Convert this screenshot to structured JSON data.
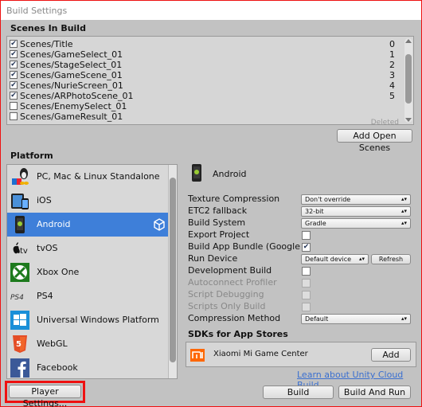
{
  "window": {
    "title": "Build Settings"
  },
  "scenes": {
    "header": "Scenes In Build",
    "items": [
      {
        "name": "Scenes/Title",
        "checked": true,
        "index": "0"
      },
      {
        "name": "Scenes/GameSelect_01",
        "checked": true,
        "index": "1"
      },
      {
        "name": "Scenes/StageSelect_01",
        "checked": true,
        "index": "2"
      },
      {
        "name": "Scenes/GameScene_01",
        "checked": true,
        "index": "3"
      },
      {
        "name": "Scenes/NurieScreen_01",
        "checked": true,
        "index": "4"
      },
      {
        "name": "Scenes/ARPhotoScene_01",
        "checked": true,
        "index": "5"
      },
      {
        "name": "Scenes/EnemySelect_01",
        "checked": false,
        "index": ""
      },
      {
        "name": "Scenes/GameResult_01",
        "checked": false,
        "index": ""
      }
    ],
    "deleted_label": "Deleted",
    "add_open_scenes": "Add Open Scenes"
  },
  "platform": {
    "header": "Platform",
    "items": [
      {
        "label": "PC, Mac & Linux Standalone",
        "icon": "pc-mac-linux-icon"
      },
      {
        "label": "iOS",
        "icon": "ios-icon"
      },
      {
        "label": "Android",
        "icon": "android-icon",
        "selected": true
      },
      {
        "label": "tvOS",
        "icon": "tvos-icon"
      },
      {
        "label": "Xbox One",
        "icon": "xbox-icon"
      },
      {
        "label": "PS4",
        "icon": "ps4-icon"
      },
      {
        "label": "Universal Windows Platform",
        "icon": "windows-icon"
      },
      {
        "label": "WebGL",
        "icon": "html5-icon"
      },
      {
        "label": "Facebook",
        "icon": "facebook-icon"
      }
    ],
    "player_settings": "Player Settings..."
  },
  "android": {
    "title": "Android",
    "texture_compression": {
      "label": "Texture Compression",
      "value": "Don't override"
    },
    "etc2_fallback": {
      "label": "ETC2 fallback",
      "value": "32-bit"
    },
    "build_system": {
      "label": "Build System",
      "value": "Gradle"
    },
    "export_project": {
      "label": "Export Project",
      "checked": false
    },
    "build_app_bundle": {
      "label": "Build App Bundle (Google Play)",
      "checked": true
    },
    "run_device": {
      "label": "Run Device",
      "value": "Default device",
      "refresh": "Refresh"
    },
    "development_build": {
      "label": "Development Build",
      "checked": false
    },
    "autoconnect_profiler": {
      "label": "Autoconnect Profiler"
    },
    "script_debugging": {
      "label": "Script Debugging"
    },
    "scripts_only_build": {
      "label": "Scripts Only Build"
    },
    "compression_method": {
      "label": "Compression Method",
      "value": "Default"
    },
    "sdks_header": "SDKs for App Stores",
    "sdk_item": {
      "label": "Xiaomi Mi Game Center",
      "add": "Add"
    },
    "cloud_link": "Learn about Unity Cloud Build"
  },
  "footer": {
    "build": "Build",
    "build_and_run": "Build And Run"
  },
  "colors": {
    "selected": "#3e7fd9",
    "highlight_border": "#e11111",
    "link": "#3a6fd0"
  }
}
